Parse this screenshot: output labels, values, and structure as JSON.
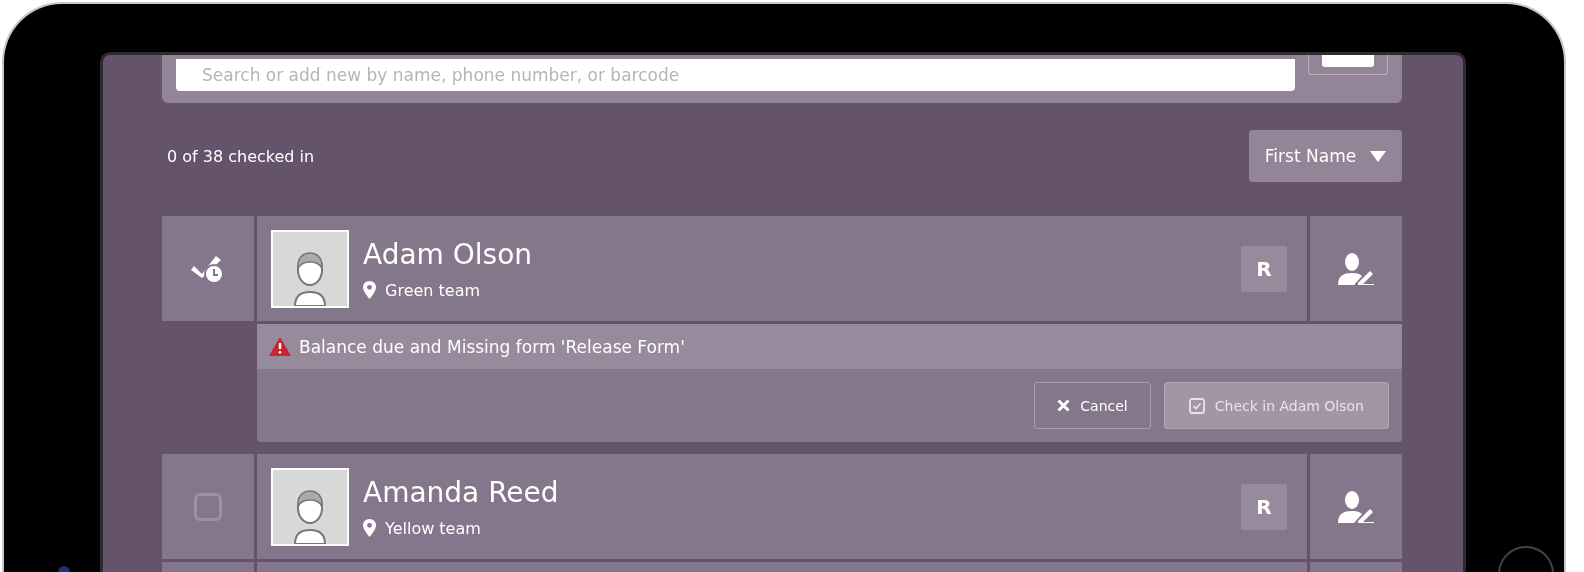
{
  "search": {
    "placeholder": "Search or add new by name, phone number, or barcode"
  },
  "summary": "0 of 38 checked in",
  "sort": {
    "label": "First Name"
  },
  "people": [
    {
      "kind": "pending",
      "name": "Adam Olson",
      "location": "Green team",
      "badge": "R",
      "alert": {
        "message": "Balance due and Missing form 'Release Form'",
        "cancel": "Cancel",
        "confirm": "Check in Adam Olson"
      }
    },
    {
      "kind": "checkbox",
      "checked": false,
      "name": "Amanda Reed",
      "location": "Yellow team",
      "badge": "R"
    },
    {
      "kind": "stub"
    }
  ]
}
